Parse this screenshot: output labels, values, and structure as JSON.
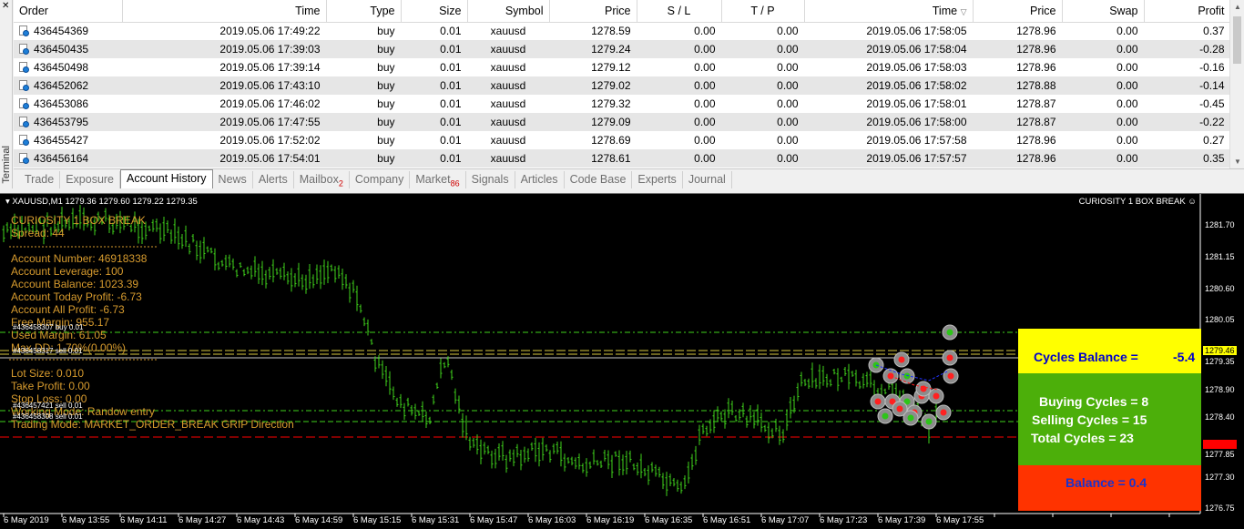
{
  "terminal": {
    "label": "Terminal",
    "close_glyph": "✕"
  },
  "table": {
    "columns": [
      "Order",
      "Time",
      "Type",
      "Size",
      "Symbol",
      "Price",
      "S / L",
      "T / P",
      "Time",
      "Price",
      "Swap",
      "Profit"
    ],
    "sort_indicator": "▽",
    "rows": [
      {
        "order": "436454369",
        "open_time": "2019.05.06 17:49:22",
        "type": "buy",
        "size": "0.01",
        "symbol": "xauusd",
        "open_price": "1278.59",
        "sl": "0.00",
        "tp": "0.00",
        "close_time": "2019.05.06 17:58:05",
        "close_price": "1278.96",
        "swap": "0.00",
        "profit": "0.37"
      },
      {
        "order": "436450435",
        "open_time": "2019.05.06 17:39:03",
        "type": "buy",
        "size": "0.01",
        "symbol": "xauusd",
        "open_price": "1279.24",
        "sl": "0.00",
        "tp": "0.00",
        "close_time": "2019.05.06 17:58:04",
        "close_price": "1278.96",
        "swap": "0.00",
        "profit": "-0.28"
      },
      {
        "order": "436450498",
        "open_time": "2019.05.06 17:39:14",
        "type": "buy",
        "size": "0.01",
        "symbol": "xauusd",
        "open_price": "1279.12",
        "sl": "0.00",
        "tp": "0.00",
        "close_time": "2019.05.06 17:58:03",
        "close_price": "1278.96",
        "swap": "0.00",
        "profit": "-0.16"
      },
      {
        "order": "436452062",
        "open_time": "2019.05.06 17:43:10",
        "type": "buy",
        "size": "0.01",
        "symbol": "xauusd",
        "open_price": "1279.02",
        "sl": "0.00",
        "tp": "0.00",
        "close_time": "2019.05.06 17:58:02",
        "close_price": "1278.88",
        "swap": "0.00",
        "profit": "-0.14"
      },
      {
        "order": "436453086",
        "open_time": "2019.05.06 17:46:02",
        "type": "buy",
        "size": "0.01",
        "symbol": "xauusd",
        "open_price": "1279.32",
        "sl": "0.00",
        "tp": "0.00",
        "close_time": "2019.05.06 17:58:01",
        "close_price": "1278.87",
        "swap": "0.00",
        "profit": "-0.45"
      },
      {
        "order": "436453795",
        "open_time": "2019.05.06 17:47:55",
        "type": "buy",
        "size": "0.01",
        "symbol": "xauusd",
        "open_price": "1279.09",
        "sl": "0.00",
        "tp": "0.00",
        "close_time": "2019.05.06 17:58:00",
        "close_price": "1278.87",
        "swap": "0.00",
        "profit": "-0.22"
      },
      {
        "order": "436455427",
        "open_time": "2019.05.06 17:52:02",
        "type": "buy",
        "size": "0.01",
        "symbol": "xauusd",
        "open_price": "1278.69",
        "sl": "0.00",
        "tp": "0.00",
        "close_time": "2019.05.06 17:57:58",
        "close_price": "1278.96",
        "swap": "0.00",
        "profit": "0.27"
      },
      {
        "order": "436456164",
        "open_time": "2019.05.06 17:54:01",
        "type": "buy",
        "size": "0.01",
        "symbol": "xauusd",
        "open_price": "1278.61",
        "sl": "0.00",
        "tp": "0.00",
        "close_time": "2019.05.06 17:57:57",
        "close_price": "1278.96",
        "swap": "0.00",
        "profit": "0.35"
      }
    ]
  },
  "tabs": [
    {
      "label": "Trade",
      "badge": ""
    },
    {
      "label": "Exposure",
      "badge": ""
    },
    {
      "label": "Account History",
      "badge": "",
      "active": true
    },
    {
      "label": "News",
      "badge": ""
    },
    {
      "label": "Alerts",
      "badge": ""
    },
    {
      "label": "Mailbox",
      "badge": "2"
    },
    {
      "label": "Company",
      "badge": ""
    },
    {
      "label": "Market",
      "badge": "86"
    },
    {
      "label": "Signals",
      "badge": ""
    },
    {
      "label": "Articles",
      "badge": ""
    },
    {
      "label": "Code Base",
      "badge": ""
    },
    {
      "label": "Experts",
      "badge": ""
    },
    {
      "label": "Journal",
      "badge": ""
    }
  ],
  "chart": {
    "symbol_line": "XAUUSD,M1  1279.36 1279.60 1279.22 1279.35",
    "expert_name": "CURIOSITY 1 BOX BREAK",
    "expert_icon": "smiley-icon",
    "info_lines": [
      "CURIOSITY 1 BOX BREAK",
      "Spread: 44",
      "Account Number: 46918338",
      "Account Leverage: 100",
      "Account Balance: 1023.39",
      "Account Today Profit: -6.73",
      "Account All Profit: -6.73",
      "Free Margin: 955.17",
      "Used Margin: 61.05",
      "Max DD: 1.70%(0.00%)",
      "Lot Size: 0.010",
      "Take Profit: 0.00",
      "Stop Loss: 0.00",
      "Working Mode:  Randow entry",
      "Trading Mode: MARKET_ORDER_BREAK GRIP Direction"
    ],
    "order_tags": [
      "#436458307 buy 0.01",
      "#436458317 sell 0.01",
      "#436457421 sell 0.01",
      "#436458308 sell 0.01"
    ],
    "price_levels": [
      "1281.70",
      "1281.15",
      "1280.60",
      "1280.05",
      "1279.46",
      "1279.35",
      "1278.90",
      "1278.40",
      "1277.95",
      "1277.85",
      "1277.30",
      "1276.75"
    ],
    "time_labels": [
      "6 May 2019",
      "6 May 13:55",
      "6 May 14:11",
      "6 May 14:27",
      "6 May 14:43",
      "6 May 14:59",
      "6 May 15:15",
      "6 May 15:31",
      "6 May 15:47",
      "6 May 16:03",
      "6 May 16:19",
      "6 May 16:35",
      "6 May 16:51",
      "6 May 17:07",
      "6 May 17:23",
      "6 May 17:39",
      "6 May 17:55"
    ],
    "colors": {
      "background": "#000000",
      "bars": "#3fd21c",
      "info_text": "#d79b2e",
      "bid_line": "#ff0000",
      "ask_badge": "#ffff00"
    }
  },
  "stats": {
    "cycles_balance_label": "Cycles Balance =",
    "cycles_balance_value": "-5.4",
    "buying_cycles": "Buying Cycles = 8",
    "selling_cycles": "Selling Cycles = 15",
    "total_cycles": "Total Cycles    = 23",
    "balance": "Balance = 0.4"
  }
}
